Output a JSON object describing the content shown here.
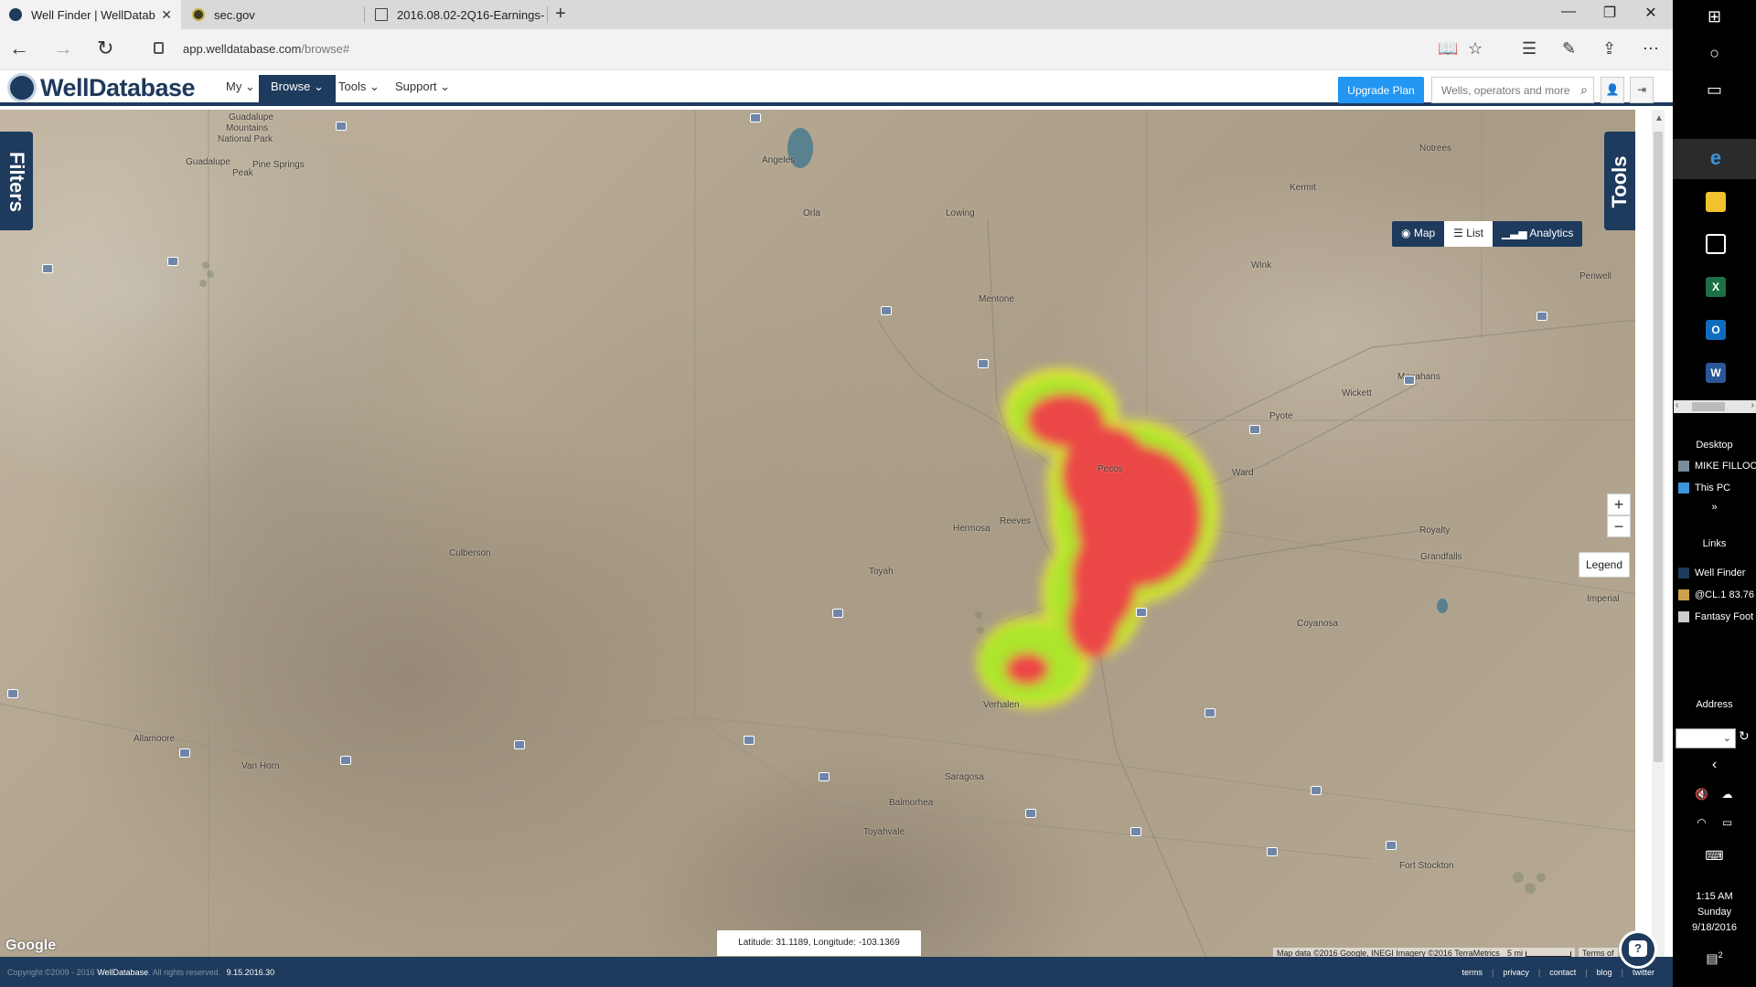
{
  "browser": {
    "tabs": [
      {
        "title": "Well Finder | WellDatab",
        "active": true
      },
      {
        "title": "sec.gov",
        "active": false
      },
      {
        "title": "2016.08.02-2Q16-Earnings-",
        "active": false
      }
    ],
    "address_host": "app.welldatabase.com",
    "address_path": "/browse#"
  },
  "header": {
    "logo_text": "WellDatabase",
    "nav": [
      {
        "label": "My"
      },
      {
        "label": "Browse"
      },
      {
        "label": "Tools"
      },
      {
        "label": "Support"
      }
    ],
    "upgrade_label": "Upgrade Plan",
    "search_placeholder": "Wells, operators and more"
  },
  "map": {
    "filters_label": "Filters",
    "tools_label": "Tools",
    "view_modes": [
      {
        "label": "Map",
        "icon": "globe-icon"
      },
      {
        "label": "List",
        "icon": "list-icon"
      },
      {
        "label": "Analytics",
        "icon": "bar-chart-icon"
      }
    ],
    "active_view": "Analytics",
    "zoom_in": "+",
    "zoom_out": "−",
    "legend_label": "Legend",
    "latlon_text": "Latitude: 31.1189, Longitude: -103.1369",
    "google_label": "Google",
    "attribution": "Map data ©2016 Google, INEGI Imagery ©2016 TerraMetrics",
    "scale_label": "5 mi",
    "terms_label": "Terms of",
    "help_label": "?",
    "places": [
      {
        "name": "Guadalupe"
      },
      {
        "name": "Mountains"
      },
      {
        "name": "National Park"
      },
      {
        "name": "Guadalupe"
      },
      {
        "name": "Peak"
      },
      {
        "name": "Pine Springs"
      },
      {
        "name": "Angeles"
      },
      {
        "name": "Orla"
      },
      {
        "name": "Lowing"
      },
      {
        "name": "Mentone"
      },
      {
        "name": "Kermit"
      },
      {
        "name": "Notrees"
      },
      {
        "name": "Wink"
      },
      {
        "name": "Penwell"
      },
      {
        "name": "Monahans"
      },
      {
        "name": "Wickett"
      },
      {
        "name": "Pyote"
      },
      {
        "name": "Ward"
      },
      {
        "name": "Pecos"
      },
      {
        "name": "Royalty"
      },
      {
        "name": "Grandfalls"
      },
      {
        "name": "Imperial"
      },
      {
        "name": "Coyanosa"
      },
      {
        "name": "Hermosa"
      },
      {
        "name": "Reeves"
      },
      {
        "name": "Culberson"
      },
      {
        "name": "Toyah"
      },
      {
        "name": "Verhalen"
      },
      {
        "name": "Allamoore"
      },
      {
        "name": "Van Horn"
      },
      {
        "name": "Saragosa"
      },
      {
        "name": "Balmorhea"
      },
      {
        "name": "Toyahvale"
      },
      {
        "name": "Fort Stockton"
      }
    ],
    "heatmap_colors": {
      "core": "#ec4646",
      "mid": "#a4e62c",
      "edge": "#f1f02a"
    }
  },
  "footer": {
    "copyright_prefix": "Copyright ©2009 - 2016",
    "copyright_brand": "WellDatabase",
    "copyright_suffix": ". All rights reserved.",
    "version": "9.15.2016.30",
    "links": [
      "terms",
      "privacy",
      "contact",
      "blog",
      "twitter"
    ]
  },
  "taskbar": {
    "desktop_label": "Desktop",
    "desktop_items": [
      "MIKE FILLOO",
      "This PC"
    ],
    "links_label": "Links",
    "link_items": [
      "Well Finder",
      "@CL.1 83.76",
      "Fantasy Foot"
    ],
    "address_label": "Address",
    "time": "1:15 AM",
    "day": "Sunday",
    "date": "9/18/2016",
    "notification_count": "2"
  }
}
